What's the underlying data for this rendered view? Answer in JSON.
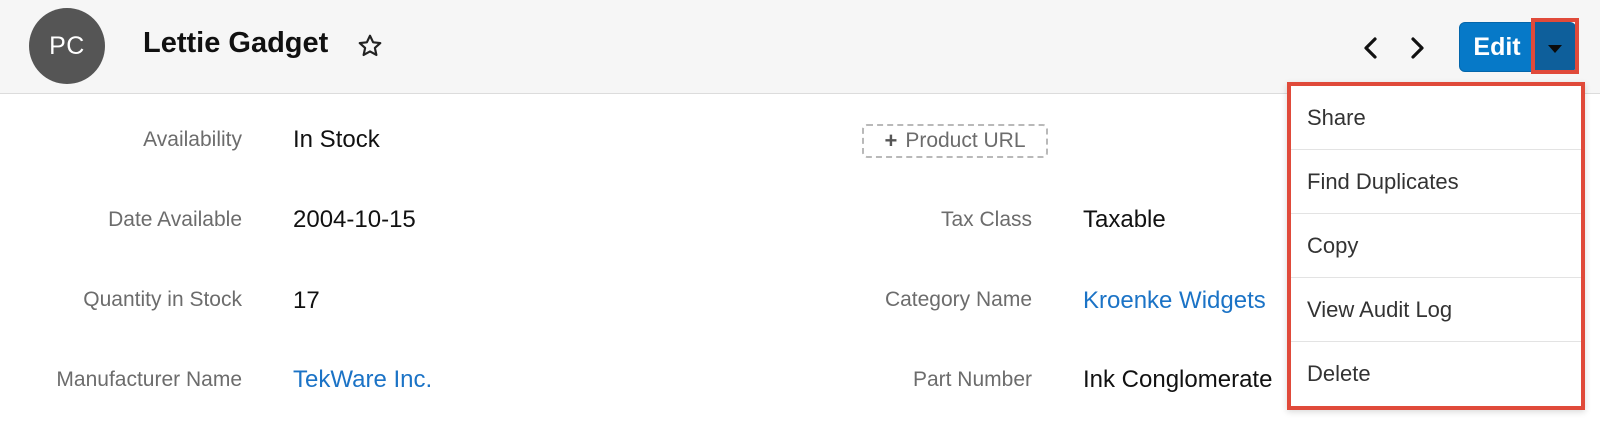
{
  "header": {
    "avatar_initials": "PC",
    "record_name": "Lettie Gadget",
    "edit_label": "Edit",
    "icons": {
      "favorite": "star-outline-icon",
      "prev": "chevron-left-icon",
      "next": "chevron-right-icon",
      "actions": "caret-down-icon"
    }
  },
  "fields": {
    "availability": {
      "label": "Availability",
      "value": "In Stock"
    },
    "date_available": {
      "label": "Date Available",
      "value": "2004-10-15"
    },
    "quantity_in_stock": {
      "label": "Quantity in Stock",
      "value": "17"
    },
    "manufacturer_name": {
      "label": "Manufacturer Name",
      "value": "TekWare Inc."
    },
    "product_url": {
      "add_label": "Product URL"
    },
    "tax_class": {
      "label": "Tax Class",
      "value": "Taxable"
    },
    "category_name": {
      "label": "Category Name",
      "value": "Kroenke Widgets"
    },
    "part_number": {
      "label": "Part Number",
      "value": "Ink Conglomerate"
    }
  },
  "actions_menu": {
    "items": [
      "Share",
      "Find Duplicates",
      "Copy",
      "View Audit Log",
      "Delete"
    ]
  },
  "colors": {
    "accent": "#0679c8",
    "link": "#1b73c6",
    "highlight": "#e04a3a"
  }
}
